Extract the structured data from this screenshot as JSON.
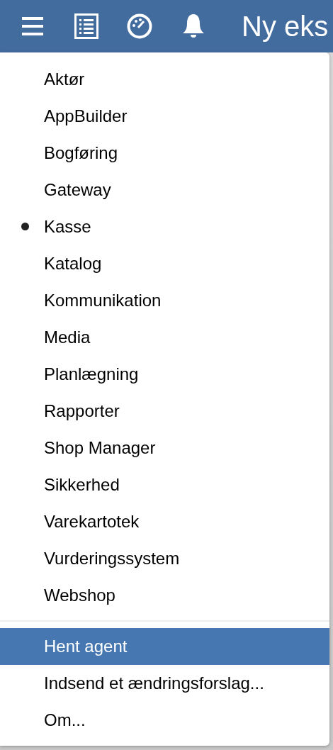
{
  "toolbar": {
    "title": "Ny eks"
  },
  "menu": {
    "modules": [
      {
        "label": "Aktør",
        "checked": false
      },
      {
        "label": "AppBuilder",
        "checked": false
      },
      {
        "label": "Bogføring",
        "checked": false
      },
      {
        "label": "Gateway",
        "checked": false
      },
      {
        "label": "Kasse",
        "checked": true
      },
      {
        "label": "Katalog",
        "checked": false
      },
      {
        "label": "Kommunikation",
        "checked": false
      },
      {
        "label": "Media",
        "checked": false
      },
      {
        "label": "Planlægning",
        "checked": false
      },
      {
        "label": "Rapporter",
        "checked": false
      },
      {
        "label": "Shop Manager",
        "checked": false
      },
      {
        "label": "Sikkerhed",
        "checked": false
      },
      {
        "label": "Varekartotek",
        "checked": false
      },
      {
        "label": "Vurderingssystem",
        "checked": false
      },
      {
        "label": "Webshop",
        "checked": false
      }
    ],
    "actions": [
      {
        "label": "Hent agent",
        "selected": true
      },
      {
        "label": "Indsend et ændringsforslag...",
        "selected": false
      },
      {
        "label": "Om...",
        "selected": false
      }
    ]
  }
}
